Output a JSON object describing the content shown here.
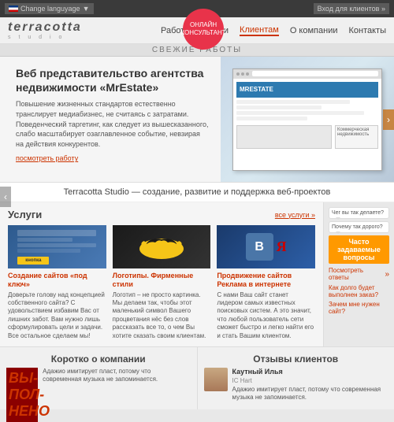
{
  "header": {
    "lang_btn": "Change languyage",
    "consultant_line1": "ОНЛАЙН",
    "consultant_line2": "КОНСУЛЬТАНТ",
    "login_btn": "Вход для клиентов"
  },
  "nav": {
    "logo": "terracotta",
    "logo_sub": "s t u d i o",
    "items": [
      {
        "label": "Работы",
        "active": false
      },
      {
        "label": "Услуги",
        "active": false
      },
      {
        "label": "Клиентам",
        "active": true
      },
      {
        "label": "О компании",
        "active": false
      },
      {
        "label": "Контакты",
        "active": false
      }
    ]
  },
  "fresh_bar": {
    "label": "СВЕЖИЕ РАБОТЫ"
  },
  "hero": {
    "title": "Веб представительство агентства недвижимости «MrEstate»",
    "description": "Повышение жизненных стандартов естественно транслирует медиабизнес, не считаясь с затратами. Поведенческий таргетинг, как следует из вышесказанного, слабо масштабирует озаглавленное событие, невзирая на действия конкурентов.",
    "link": "посмотреть работу",
    "arrow_left": "‹",
    "arrow_right": "›"
  },
  "tagline": {
    "text": "Terracotta Studio — создание, развитие и поддержка веб-проектов"
  },
  "services": {
    "title": "Услуги",
    "link": "все услуги »",
    "items": [
      {
        "title": "Создание сайтов «под ключ»",
        "desc": "Доверьте голову над концепцией собственного сайта? С удовольствием избавим Вас от лишних забот. Вам нужно лишь сформулировать цели и задачи. Все остальное сделаем мы!"
      },
      {
        "title": "Логотипы. Фирменные стили",
        "desc": "Логотип – не просто картинка. Мы делаем так, чтобы этот маленький символ Вашего процветания нёс без слов рассказать все то, о чем Вы хотите сказать своим клиентам."
      },
      {
        "title": "Продвижение сайтов Реклама в интернете",
        "desc": "С нами Ваш сайт станет лидером самых известных поисковых систем. А это значит, что любой пользователь сети сможет быстро и легко найти его и стать Вашим клиентом."
      }
    ]
  },
  "faq": {
    "bubble1": "Чег вы так делаете?",
    "bubble2": "Почему так дорого?",
    "title": "Часто задаваемые вопросы",
    "subtitle": "Посмотреть ответы",
    "item1": "Как долго будет выполнен заказ?",
    "item2": "Зачем мне нужен сайт?"
  },
  "about": {
    "title": "Коротко о компании",
    "done_text": "ВЫПОЛНЕНО",
    "text": "Адажио имитирует пласт, потому что современная музыка не запоминается."
  },
  "reviews": {
    "title": "Отзывы клиентов",
    "name": "Каутный Илья",
    "secondary_name": "IC Hart",
    "text": "Адажио имитирует пласт, потому что современная музыка не запоминается."
  }
}
